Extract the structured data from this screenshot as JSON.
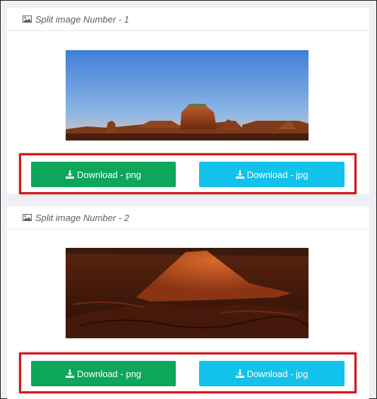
{
  "panels": [
    {
      "title": "Split image Number - 1",
      "buttons": {
        "png_label": "Download - png",
        "jpg_label": "Download - jpg"
      }
    },
    {
      "title": "Split image Number - 2",
      "buttons": {
        "png_label": "Download - png",
        "jpg_label": "Download - jpg"
      }
    }
  ],
  "colors": {
    "png_button": "#0ea65a",
    "jpg_button": "#12c2ea",
    "highlight_border": "#d9141a"
  },
  "icons": {
    "header": "image-icon",
    "button": "download-icon"
  }
}
